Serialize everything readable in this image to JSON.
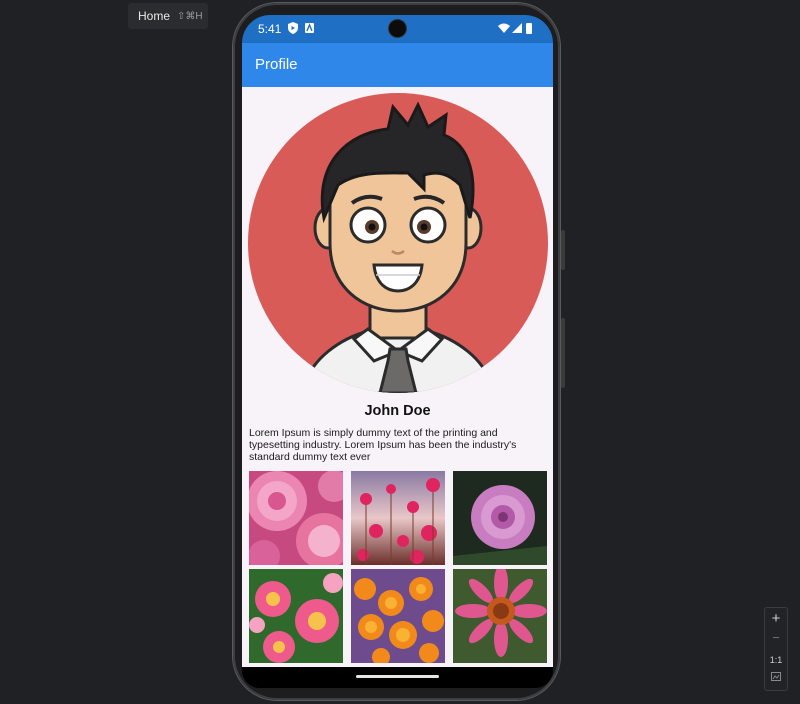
{
  "tooltip": {
    "label": "Home",
    "shortcut": "⇧⌘H"
  },
  "status_bar": {
    "time": "5:41",
    "color": "#1f6fc5",
    "icons": [
      "shield-icon",
      "apk-icon",
      "wifi-icon",
      "signal-icon",
      "battery-icon"
    ]
  },
  "app_bar": {
    "title": "Profile",
    "color": "#2f88e9"
  },
  "profile": {
    "avatar": "cartoon-man-avatar",
    "avatar_bg": "#d95b58",
    "name": "John Doe",
    "description": "Lorem Ipsum is simply dummy text of the printing and typesetting industry. Lorem Ipsum has been the industry's standard dummy text ever"
  },
  "gallery": [
    {
      "subject": "pink chrysanthemum"
    },
    {
      "subject": "pink cosmos flowers"
    },
    {
      "subject": "purple dahlia"
    },
    {
      "subject": "plumeria flowers"
    },
    {
      "subject": "orange marigolds"
    },
    {
      "subject": "pink echinacea"
    }
  ],
  "zoom_controls": {
    "zoom_in": "+",
    "zoom_out": "−",
    "actual_size": "1:1"
  }
}
